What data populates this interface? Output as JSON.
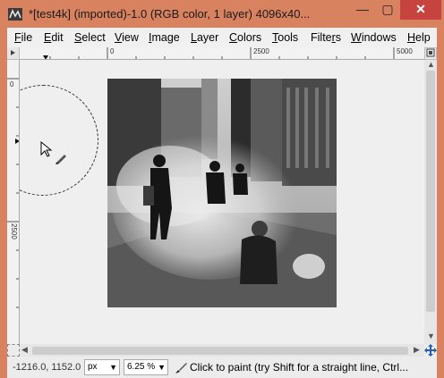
{
  "window": {
    "title": "*[test4k] (imported)-1.0 (RGB color, 1 layer) 4096x40...",
    "minimize": "—",
    "maximize": "▢",
    "close": "✕"
  },
  "menu": {
    "items": [
      "File",
      "Edit",
      "Select",
      "View",
      "Image",
      "Layer",
      "Colors",
      "Tools",
      "Filters",
      "Windows",
      "Help"
    ],
    "mnemonics": [
      "F",
      "E",
      "S",
      "V",
      "I",
      "L",
      "C",
      "T",
      "r",
      "W",
      "H"
    ]
  },
  "rulers": {
    "h_labels": [
      "0",
      "2500",
      "5000"
    ],
    "v_labels": [
      "0",
      "2500"
    ]
  },
  "status": {
    "coords": "-1216.0, 1152.0",
    "unit": "px",
    "zoom": "6.25 %",
    "message": "Click to paint (try Shift for a straight line, Ctrl..."
  },
  "icons": {
    "app": "gimp-wilber-icon",
    "navigate": "navigate-icon",
    "quick_mask": "quick-mask-icon",
    "move": "move-crosshair-icon",
    "paintbrush": "paintbrush-icon"
  },
  "colors": {
    "titlebar": "#d8825f",
    "close": "#c7433f",
    "canvas": "#efefef"
  }
}
